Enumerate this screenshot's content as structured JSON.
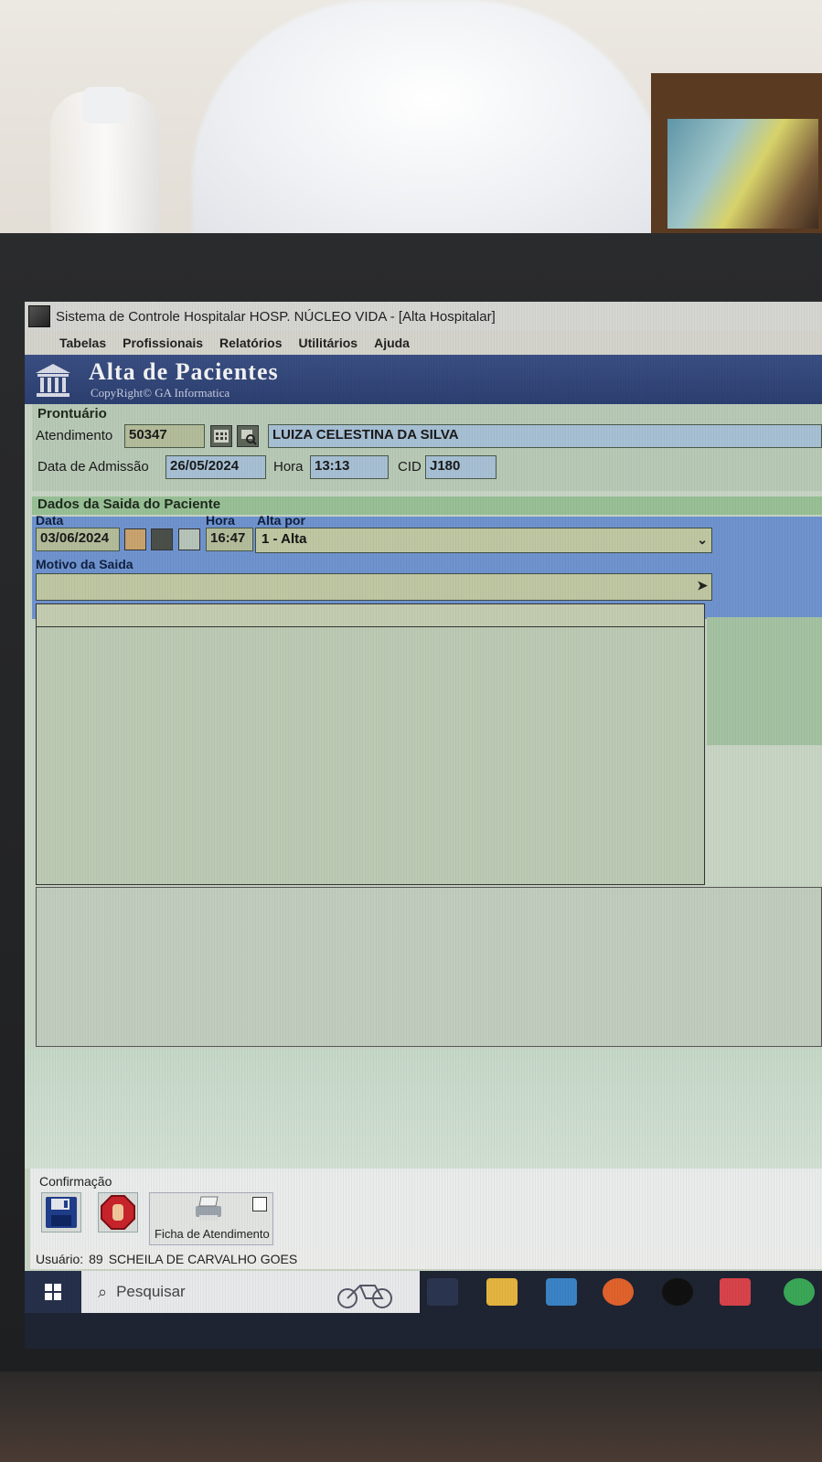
{
  "window": {
    "title": "Sistema de Controle Hospitalar HOSP. NÚCLEO VIDA - [Alta Hospitalar]"
  },
  "menu": [
    "Tabelas",
    "Profissionais",
    "Relatórios",
    "Utilitários",
    "Ajuda"
  ],
  "banner": {
    "title": "Alta de Pacientes",
    "subtitle": "CopyRight© GA Informatica"
  },
  "prontuario": {
    "group_label": "Prontuário",
    "atendimento_label": "Atendimento",
    "atendimento_value": "50347",
    "patient_name": "LUIZA CELESTINA DA SILVA",
    "admissao_label": "Data de Admissão",
    "admissao_value": "26/05/2024",
    "hora_label": "Hora",
    "hora_value": "13:13",
    "cid_label": "CID",
    "cid_value": "J180"
  },
  "saida": {
    "group_label": "Dados da Saida do Paciente",
    "data_label": "Data",
    "data_value": "03/06/2024",
    "hora_label": "Hora",
    "hora_value": "16:47",
    "alta_label": "Alta por",
    "alta_value": "1 - Alta",
    "motivo_label": "Motivo da Saida",
    "motivo_value": ""
  },
  "confirmacao": {
    "label": "Confirmação",
    "ficha_label": "Ficha de Atendimento",
    "ficha_checked": false
  },
  "status": {
    "usuario_label": "Usuário:",
    "usuario_id": "89",
    "usuario_name": "SCHEILA DE CARVALHO GOES"
  },
  "taskbar": {
    "search_placeholder": "Pesquisar",
    "icons": [
      "windows-start-icon",
      "search-icon",
      "bicycle-icon",
      "task-view-icon",
      "file-explorer-icon",
      "mail-icon",
      "firefox-icon",
      "vpn-icon",
      "anydesk-icon",
      "chrome-icon"
    ]
  },
  "colors": {
    "banner": "#2c3f70",
    "saida_band": "#6f93ce",
    "field": "#b3bc9a"
  }
}
